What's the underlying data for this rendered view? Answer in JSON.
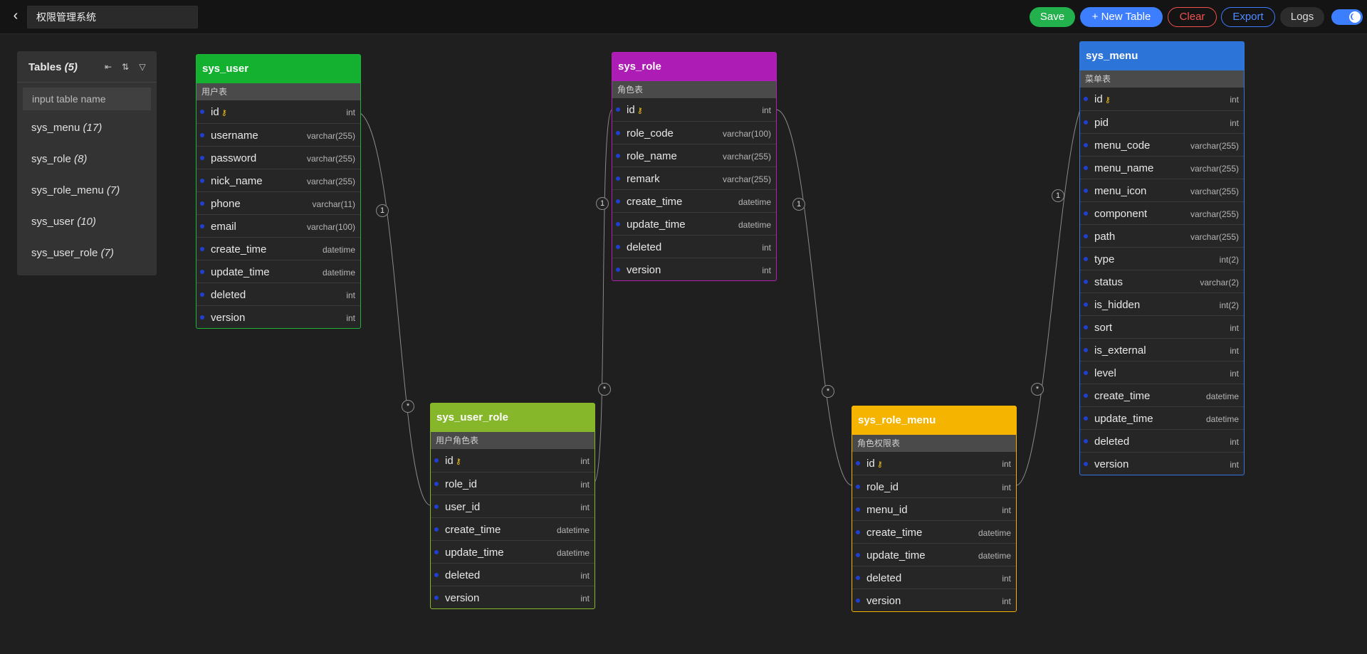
{
  "header": {
    "back_icon": "chevron-left-icon",
    "title": "权限管理系统",
    "save_label": "Save",
    "new_table_label": "+ New Table",
    "clear_label": "Clear",
    "export_label": "Export",
    "logs_label": "Logs",
    "theme_toggle_icon": "moon-icon"
  },
  "sidebar": {
    "title": "Tables",
    "count": "(5)",
    "search_placeholder": "input table name",
    "icons": [
      "collapse-icon",
      "sort-icon",
      "filter-icon"
    ],
    "items": [
      {
        "name": "sys_menu",
        "count": "(17)"
      },
      {
        "name": "sys_role",
        "count": "(8)"
      },
      {
        "name": "sys_role_menu",
        "count": "(7)"
      },
      {
        "name": "sys_user",
        "count": "(10)"
      },
      {
        "name": "sys_user_role",
        "count": "(7)"
      }
    ]
  },
  "tables": {
    "sys_user": {
      "name": "sys_user",
      "comment": "用户表",
      "color": "#13b12f",
      "fields": [
        {
          "name": "id",
          "type": "int",
          "pk": true
        },
        {
          "name": "username",
          "type": "varchar(255)"
        },
        {
          "name": "password",
          "type": "varchar(255)"
        },
        {
          "name": "nick_name",
          "type": "varchar(255)"
        },
        {
          "name": "phone",
          "type": "varchar(11)"
        },
        {
          "name": "email",
          "type": "varchar(100)"
        },
        {
          "name": "create_time",
          "type": "datetime"
        },
        {
          "name": "update_time",
          "type": "datetime"
        },
        {
          "name": "deleted",
          "type": "int"
        },
        {
          "name": "version",
          "type": "int"
        }
      ]
    },
    "sys_role": {
      "name": "sys_role",
      "comment": "角色表",
      "color": "#ad1cb4",
      "fields": [
        {
          "name": "id",
          "type": "int",
          "pk": true
        },
        {
          "name": "role_code",
          "type": "varchar(100)"
        },
        {
          "name": "role_name",
          "type": "varchar(255)"
        },
        {
          "name": "remark",
          "type": "varchar(255)"
        },
        {
          "name": "create_time",
          "type": "datetime"
        },
        {
          "name": "update_time",
          "type": "datetime"
        },
        {
          "name": "deleted",
          "type": "int"
        },
        {
          "name": "version",
          "type": "int"
        }
      ]
    },
    "sys_menu": {
      "name": "sys_menu",
      "comment": "菜单表",
      "color": "#2d74d8",
      "fields": [
        {
          "name": "id",
          "type": "int",
          "pk": true
        },
        {
          "name": "pid",
          "type": "int"
        },
        {
          "name": "menu_code",
          "type": "varchar(255)"
        },
        {
          "name": "menu_name",
          "type": "varchar(255)"
        },
        {
          "name": "menu_icon",
          "type": "varchar(255)"
        },
        {
          "name": "component",
          "type": "varchar(255)"
        },
        {
          "name": "path",
          "type": "varchar(255)"
        },
        {
          "name": "type",
          "type": "int(2)"
        },
        {
          "name": "status",
          "type": "varchar(2)"
        },
        {
          "name": "is_hidden",
          "type": "int(2)"
        },
        {
          "name": "sort",
          "type": "int"
        },
        {
          "name": "is_external",
          "type": "int"
        },
        {
          "name": "level",
          "type": "int"
        },
        {
          "name": "create_time",
          "type": "datetime"
        },
        {
          "name": "update_time",
          "type": "datetime"
        },
        {
          "name": "deleted",
          "type": "int"
        },
        {
          "name": "version",
          "type": "int"
        }
      ]
    },
    "sys_user_role": {
      "name": "sys_user_role",
      "comment": "用户角色表",
      "color": "#86b62a",
      "fields": [
        {
          "name": "id",
          "type": "int",
          "pk": true
        },
        {
          "name": "role_id",
          "type": "int"
        },
        {
          "name": "user_id",
          "type": "int"
        },
        {
          "name": "create_time",
          "type": "datetime"
        },
        {
          "name": "update_time",
          "type": "datetime"
        },
        {
          "name": "deleted",
          "type": "int"
        },
        {
          "name": "version",
          "type": "int"
        }
      ]
    },
    "sys_role_menu": {
      "name": "sys_role_menu",
      "comment": "角色权限表",
      "color": "#f4b400",
      "fields": [
        {
          "name": "id",
          "type": "int",
          "pk": true
        },
        {
          "name": "role_id",
          "type": "int"
        },
        {
          "name": "menu_id",
          "type": "int"
        },
        {
          "name": "create_time",
          "type": "datetime"
        },
        {
          "name": "update_time",
          "type": "datetime"
        },
        {
          "name": "deleted",
          "type": "int"
        },
        {
          "name": "version",
          "type": "int"
        }
      ]
    }
  },
  "relations": [
    {
      "from": "sys_user.id",
      "to": "sys_user_role.user_id",
      "one": "1",
      "many": "*"
    },
    {
      "from": "sys_role.id",
      "to": "sys_user_role.role_id",
      "one": "1",
      "many": "*"
    },
    {
      "from": "sys_role.id",
      "to": "sys_role_menu.role_id",
      "one": "1",
      "many": "*"
    },
    {
      "from": "sys_menu.id",
      "to": "sys_role_menu.menu_id",
      "one": "1",
      "many": "*"
    }
  ]
}
